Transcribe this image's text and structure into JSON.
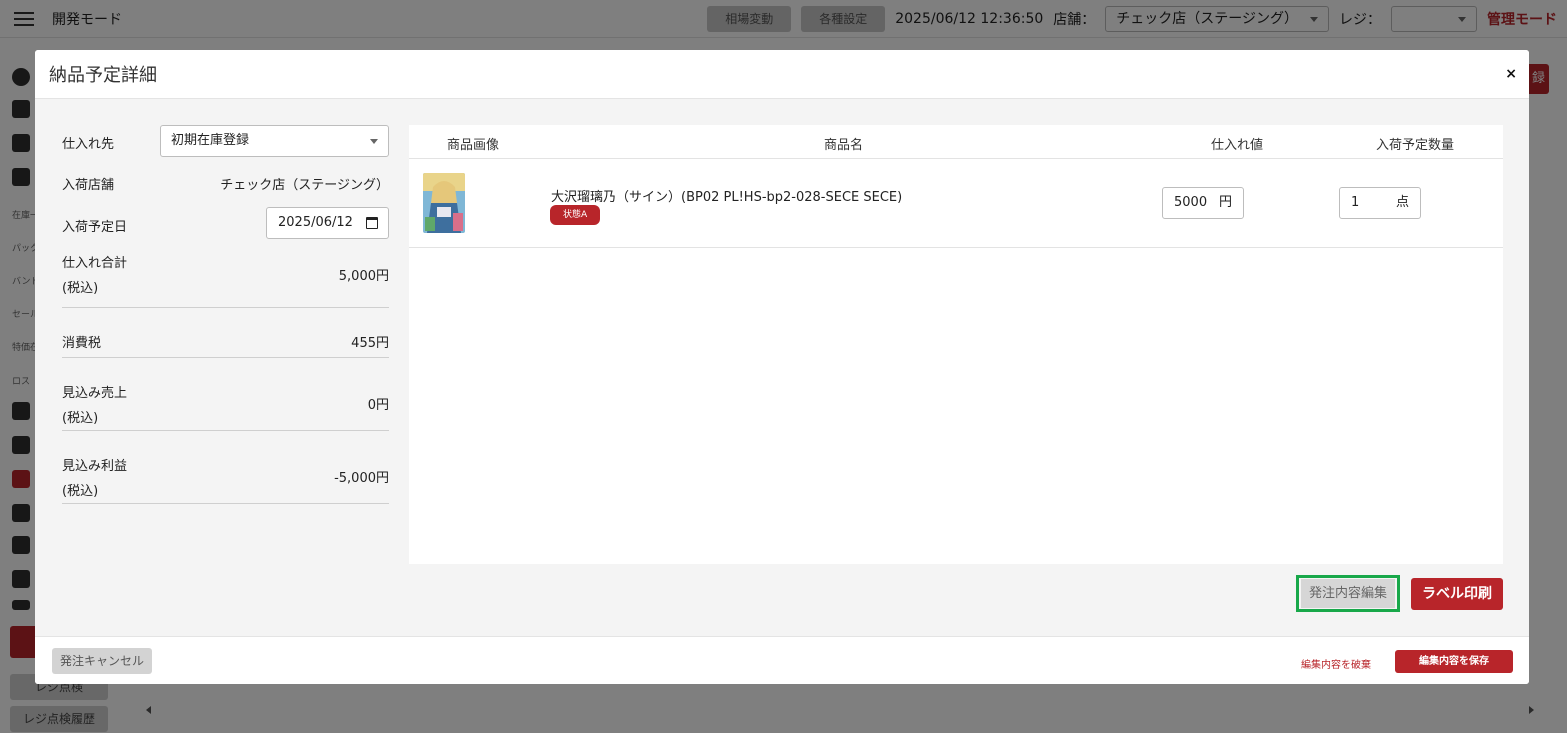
{
  "app": {
    "title": "開発モード",
    "market_btn": "相場変動",
    "settings_btn": "各種設定",
    "datetime": "2025/06/12 12:36:50",
    "store_label": "店舗：",
    "store_value": "チェック店（ステージング）",
    "register_label": "レジ：",
    "register_value": "",
    "admin_mode": "管理モード",
    "register_check": "レジ点検",
    "register_history": "レジ点検履歴",
    "bg_button": "録",
    "sidebar_labels": [
      "在庫一",
      "パック",
      "バンド",
      "セール",
      "特価在",
      "ロス"
    ]
  },
  "modal": {
    "title": "納品予定詳細",
    "close": "×",
    "supplier_label": "仕入れ先",
    "supplier_value": "初期在庫登録",
    "store_label": "入荷店舗",
    "store_value": "チェック店（ステージング）",
    "date_label": "入荷予定日",
    "date_value": "2025/06/12",
    "purchase_total_label": "仕入れ合計",
    "tax_included": "(税込)",
    "purchase_total_value": "5,000円",
    "tax_label": "消費税",
    "tax_value": "455円",
    "expected_sales_label": "見込み売上",
    "expected_sales_value": "0円",
    "expected_profit_label": "見込み利益",
    "expected_profit_value": "-5,000円",
    "table": {
      "headers": [
        "商品画像",
        "商品名",
        "仕入れ値",
        "入荷予定数量"
      ],
      "rows": [
        {
          "name": "大沢瑠璃乃（サイン）(BP02 PL!HS-bp2-028-SECE SECE)",
          "condition": "状態A",
          "price": "5000",
          "price_unit": "円",
          "qty": "1",
          "qty_unit": "点"
        }
      ]
    },
    "edit_order_btn": "発注内容編集",
    "print_label_btn": "ラベル印刷",
    "cancel_order_btn": "発注キャンセル",
    "discard_btn": "編集内容を破棄",
    "save_btn": "編集内容を保存"
  }
}
